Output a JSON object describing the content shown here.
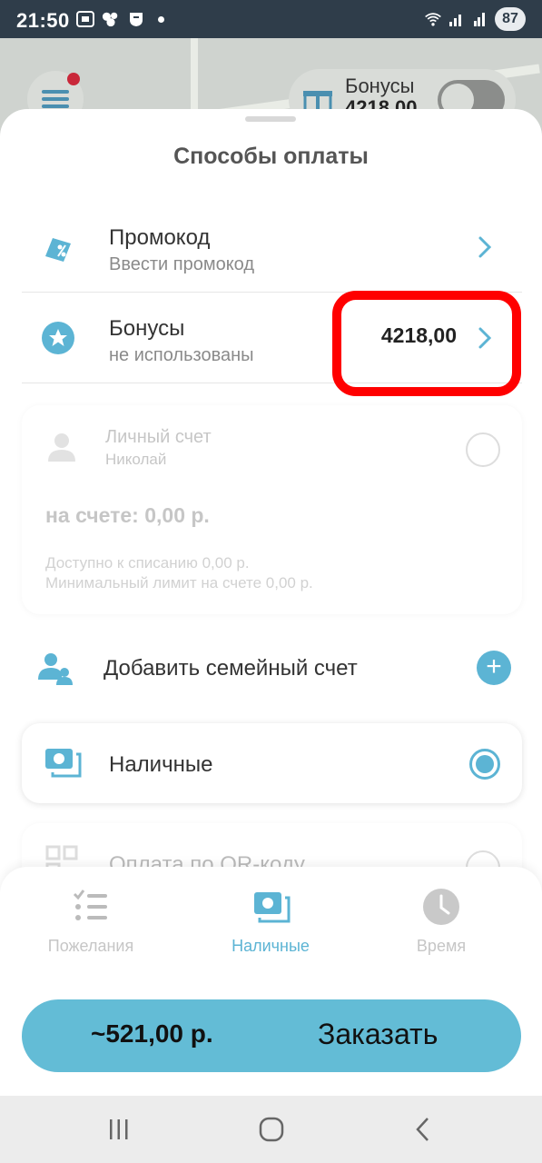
{
  "status_bar": {
    "time": "21:50",
    "battery": "87"
  },
  "map_header": {
    "bonus_label": "Бонусы",
    "bonus_value": "4218,00"
  },
  "sheet": {
    "title": "Способы оплаты",
    "promo": {
      "title": "Промокод",
      "subtitle": "Ввести промокод"
    },
    "bonuses": {
      "title": "Бонусы",
      "subtitle": "не использованы",
      "value": "4218,00"
    },
    "personal_account": {
      "title": "Личный счет",
      "owner": "Николай",
      "balance": "на счете: 0,00 р.",
      "available": "Доступно к списанию 0,00 р.",
      "min_limit": "Минимальный лимит на счете 0,00 р."
    },
    "family": {
      "title": "Добавить семейный счет"
    },
    "cash": {
      "title": "Наличные"
    },
    "qr": {
      "title": "Оплата по QR-коду"
    }
  },
  "tabs": [
    {
      "label": "Пожелания"
    },
    {
      "label": "Наличные"
    },
    {
      "label": "Время"
    }
  ],
  "order": {
    "price": "~521,00 р.",
    "label": "Заказать"
  },
  "colors": {
    "accent": "#5cb4d4",
    "order_button": "#63bcd6",
    "highlight": "#ff0000"
  }
}
